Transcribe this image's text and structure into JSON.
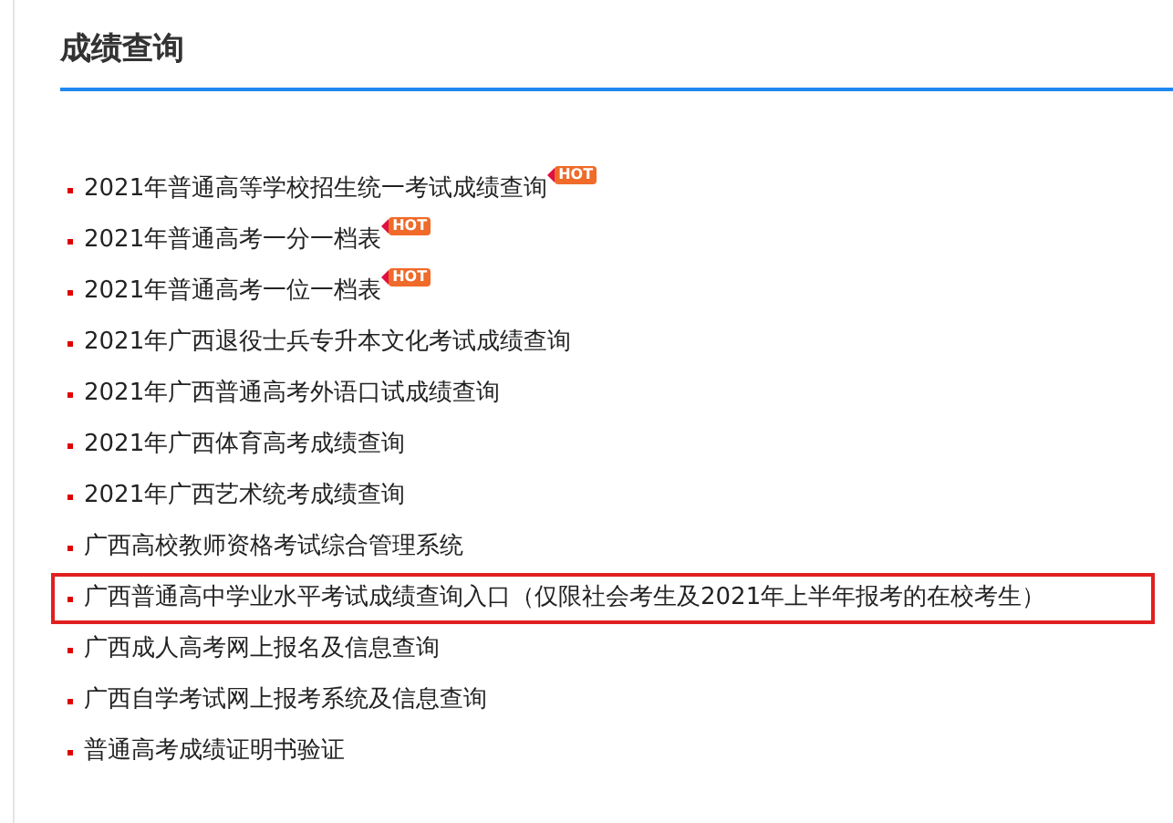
{
  "section": {
    "title": "成绩查询"
  },
  "links": [
    {
      "label": "2021年普通高等学校招生统一考试成绩查询",
      "badge": "HOT",
      "highlighted": false
    },
    {
      "label": "2021年普通高考一分一档表",
      "badge": "HOT",
      "highlighted": false
    },
    {
      "label": "2021年普通高考一位一档表",
      "badge": "HOT",
      "highlighted": false
    },
    {
      "label": "2021年广西退役士兵专升本文化考试成绩查询",
      "highlighted": false
    },
    {
      "label": "2021年广西普通高考外语口试成绩查询",
      "highlighted": false
    },
    {
      "label": "2021年广西体育高考成绩查询",
      "highlighted": false
    },
    {
      "label": "2021年广西艺术统考成绩查询",
      "highlighted": false
    },
    {
      "label": "广西高校教师资格考试综合管理系统",
      "highlighted": false
    },
    {
      "label": "广西普通高中学业水平考试成绩查询入口（仅限社会考生及2021年上半年报考的在校考生）",
      "highlighted": true
    },
    {
      "label": "广西成人高考网上报名及信息查询",
      "highlighted": false
    },
    {
      "label": "广西自学考试网上报考系统及信息查询",
      "highlighted": false
    },
    {
      "label": "普通高考成绩证明书验证",
      "highlighted": false
    }
  ]
}
